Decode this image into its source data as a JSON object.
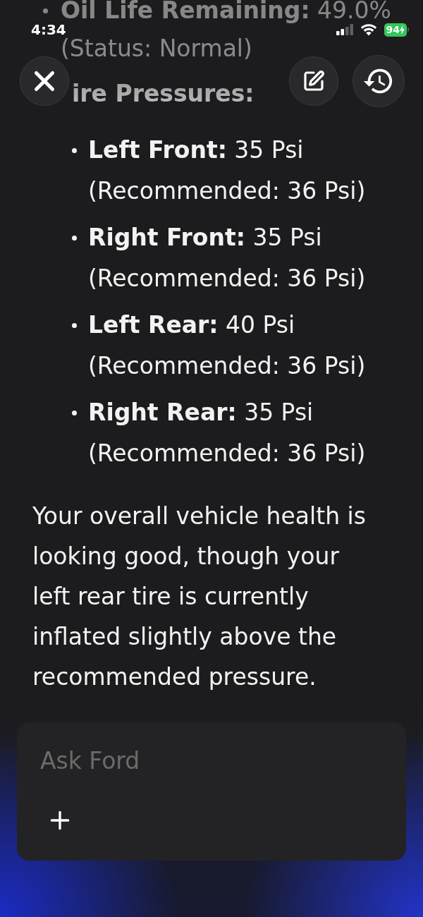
{
  "status_bar": {
    "time": "4:34",
    "battery": "94"
  },
  "response": {
    "items": [
      {
        "kind": "bullet",
        "text": "**Oil Life Remaining:** 49.0%",
        "note": "(Status: Normal)"
      },
      {
        "kind": "heading",
        "text": "**ire Pressures:**",
        "children": [
          {
            "text": "**Left Front:** 35 Psi (Recommended: 36 Psi)"
          },
          {
            "text": "**Right Front:** 35 Psi (Recommended: 36 Psi)"
          },
          {
            "text": "**Left Rear:** 40 Psi (Recommended: 36 Psi)"
          },
          {
            "text": "**Right Rear:** 35 Psi (Recommended: 36 Psi)"
          }
        ]
      }
    ],
    "summary": "Your overall vehicle health is looking good, though your left rear tire is currently inflated slightly above the recommended pressure."
  },
  "composer": {
    "placeholder": "Ask Ford"
  }
}
